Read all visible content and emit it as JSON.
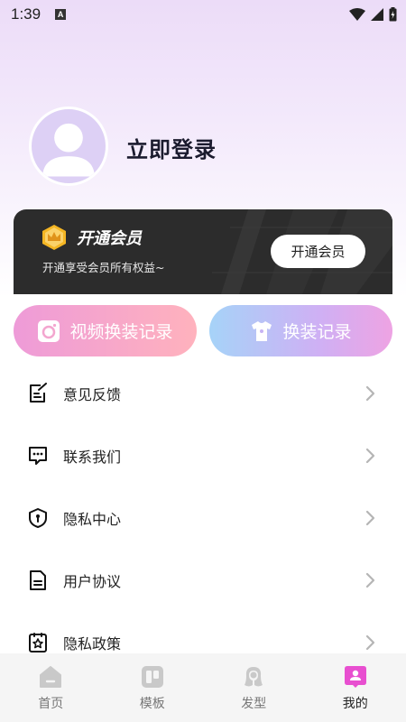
{
  "status_bar": {
    "time": "1:39",
    "notification_icon": "a-icon",
    "wifi_icon": "wifi-icon",
    "signal_icon": "signal-icon",
    "battery_icon": "battery-icon"
  },
  "profile": {
    "avatar_icon": "user-avatar-icon",
    "login_text": "立即登录"
  },
  "vip": {
    "title": "开通会员",
    "subtitle": "开通享受会员所有权益~",
    "button_label": "开通会员",
    "badge_icon": "crown-badge-icon"
  },
  "records": {
    "video_label": "视频换装记录",
    "video_icon": "camera-icon",
    "outfit_label": "换装记录",
    "outfit_icon": "tshirt-icon"
  },
  "menu": [
    {
      "label": "意见反馈",
      "icon": "feedback-icon"
    },
    {
      "label": "联系我们",
      "icon": "chat-icon"
    },
    {
      "label": "隐私中心",
      "icon": "shield-icon"
    },
    {
      "label": "用户协议",
      "icon": "document-icon"
    },
    {
      "label": "隐私政策",
      "icon": "policy-icon"
    }
  ],
  "bottom_nav": [
    {
      "label": "首页",
      "icon": "home-icon",
      "active": false
    },
    {
      "label": "模板",
      "icon": "template-icon",
      "active": false
    },
    {
      "label": "发型",
      "icon": "hairstyle-icon",
      "active": false
    },
    {
      "label": "我的",
      "icon": "profile-icon",
      "active": true
    }
  ],
  "colors": {
    "accent": "#e84fd0",
    "vip_card_bg": "#2c2c2c",
    "gold": "#f5b623"
  }
}
